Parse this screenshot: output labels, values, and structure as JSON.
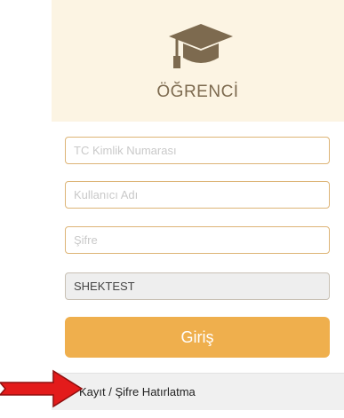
{
  "header": {
    "icon": "graduation-cap-icon",
    "title": "ÖĞRENCİ",
    "background": "#fcf4e3",
    "icon_color": "#7d6a4f"
  },
  "form": {
    "tc_placeholder": "TC Kimlik Numarası",
    "tc_value": "",
    "username_placeholder": "Kullanıcı Adı",
    "username_value": "",
    "password_placeholder": "Şifre",
    "password_value": "",
    "code_value": "SHEKTEST",
    "login_label": "Giriş",
    "accent_color": "#efaf4d",
    "border_color": "#ddb476"
  },
  "footer": {
    "link_label": "Kayıt / Şifre Hatırlatma"
  },
  "annotation": {
    "arrow_icon": "red-arrow-icon",
    "arrow_color": "#e31b1b"
  }
}
